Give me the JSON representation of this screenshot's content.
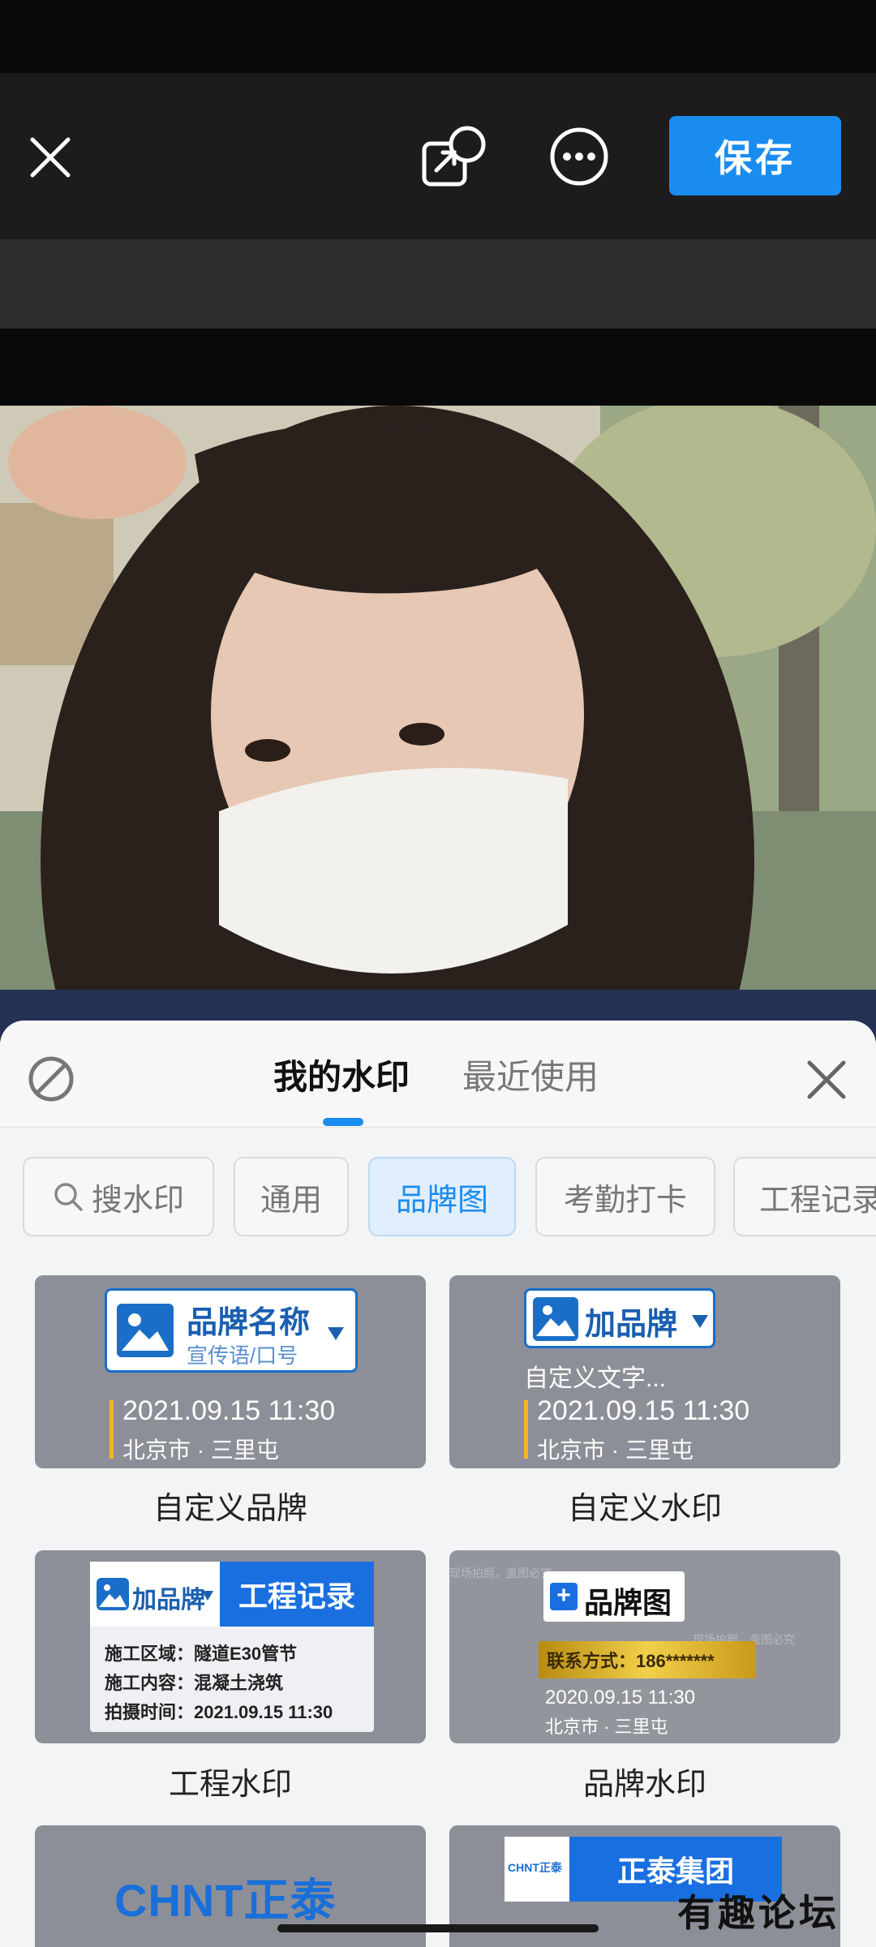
{
  "toolbar": {
    "save_label": "保存"
  },
  "panel": {
    "tabs": [
      {
        "label": "我的水印"
      },
      {
        "label": "最近使用"
      }
    ]
  },
  "filters": {
    "search_placeholder": "搜水印",
    "chips": [
      {
        "label": "通用"
      },
      {
        "label": "品牌图"
      },
      {
        "label": "考勤打卡"
      },
      {
        "label": "工程记录"
      }
    ],
    "active_chip": "品牌图"
  },
  "cards": [
    {
      "caption": "自定义品牌",
      "brand": "品牌名称",
      "slogan": "宣传语/口号",
      "date": "2021.09.15  11:30",
      "location": "北京市 · 三里屯"
    },
    {
      "caption": "自定义水印",
      "brand": "加品牌",
      "custom_text": "自定义文字...",
      "date": "2021.09.15  11:30",
      "location": "北京市 · 三里屯"
    },
    {
      "caption": "工程水印",
      "brand": "加品牌",
      "tag": "工程记录",
      "area": "施工区域：隧道E30管节",
      "content": "施工内容：混凝土浇筑",
      "time": "拍摄时间：2021.09.15 11:30"
    },
    {
      "caption": "品牌水印",
      "brand": "品牌图",
      "contact": "联系方式：186*******",
      "date": "2020.09.15  11:30",
      "location": "北京市 · 三里屯",
      "bg_text": "现场拍照，盖图必究"
    },
    {
      "logo": "CHNT正泰"
    },
    {
      "logo_small": "CHNT正泰",
      "company": "正泰集团"
    }
  ],
  "watermark_overlay": "有趣论坛",
  "colors": {
    "accent": "#1a8cf0",
    "card_bg": "#8d8f98",
    "brand_blue": "#1a6ec7",
    "gold": "#e7b820"
  }
}
